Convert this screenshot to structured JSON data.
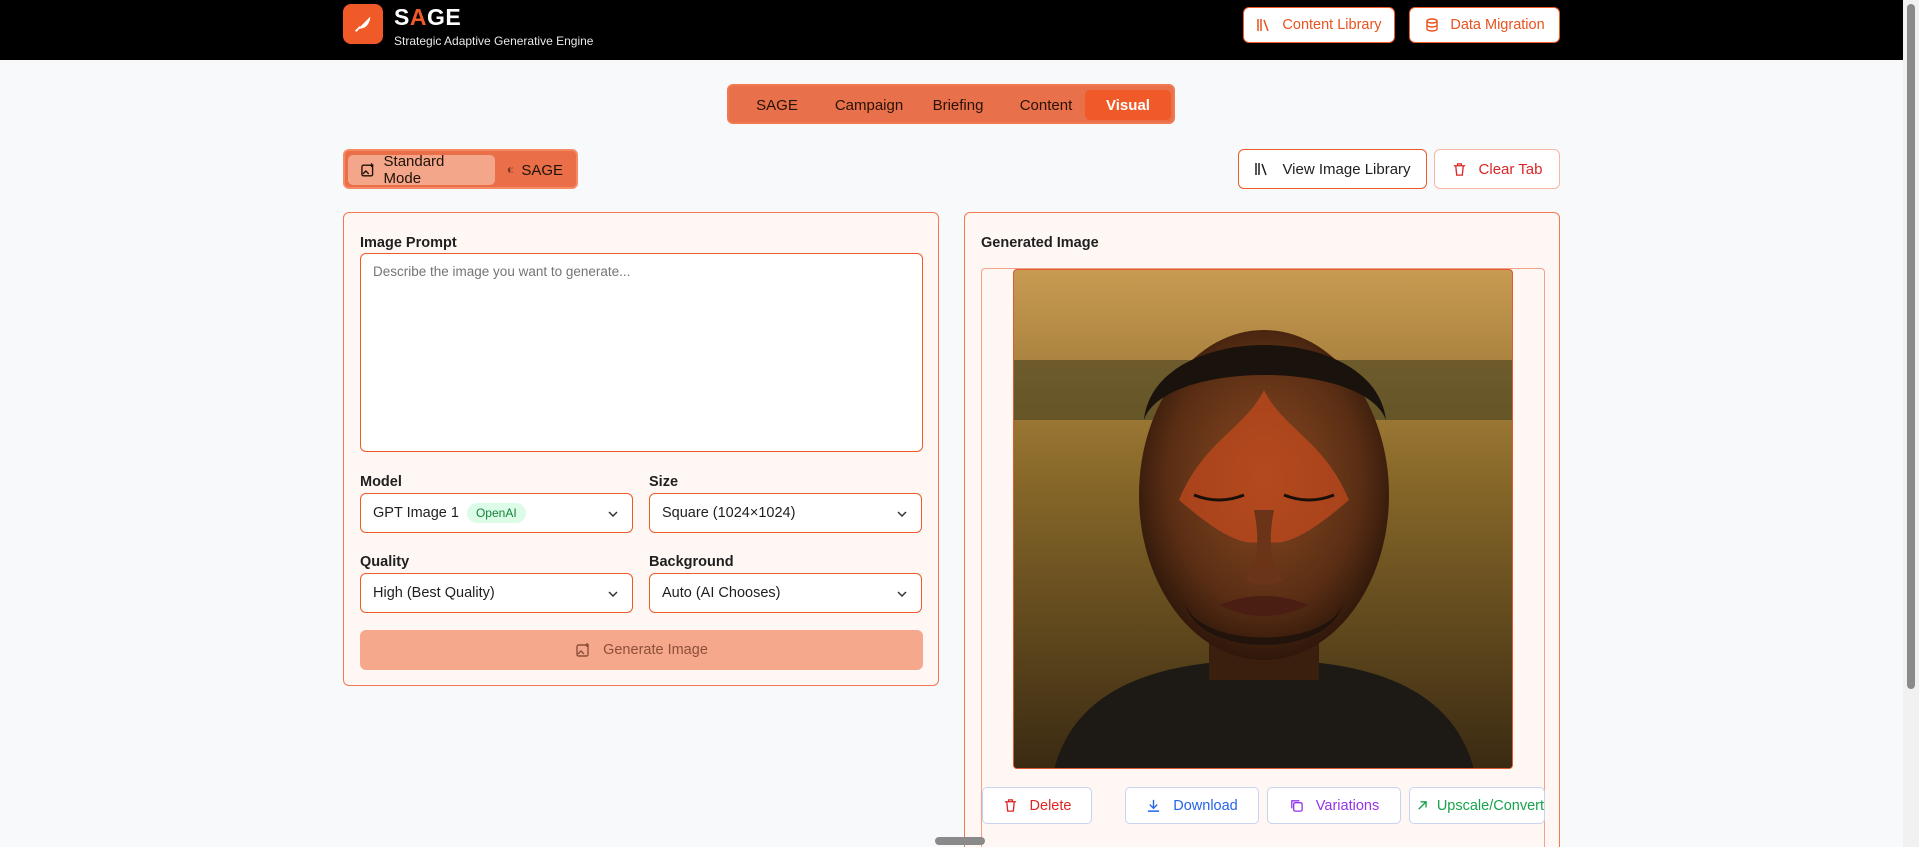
{
  "header": {
    "brand_prefix": "S",
    "brand_accent": "A",
    "brand_suffix": "GE",
    "tagline": "Strategic Adaptive Generative Engine",
    "content_library": "Content Library",
    "data_migration": "Data Migration"
  },
  "tabs": [
    "SAGE",
    "Campaign",
    "Briefing",
    "Content",
    "Visual"
  ],
  "active_tab": "Visual",
  "modes": {
    "standard": "Standard Mode",
    "sage": "SAGE",
    "active": "Standard Mode"
  },
  "actions": {
    "view_library": "View Image Library",
    "clear_tab": "Clear Tab"
  },
  "form": {
    "prompt_label": "Image Prompt",
    "prompt_placeholder": "Describe the image you want to generate...",
    "model_label": "Model",
    "model_value": "GPT Image 1",
    "model_badge": "OpenAI",
    "size_label": "Size",
    "size_value": "Square (1024×1024)",
    "quality_label": "Quality",
    "quality_value": "High (Best Quality)",
    "background_label": "Background",
    "background_value": "Auto (AI Chooses)",
    "generate": "Generate Image"
  },
  "result": {
    "title": "Generated Image",
    "delete": "Delete",
    "download": "Download",
    "variations": "Variations",
    "upscale": "Upscale/Convert"
  },
  "colors": {
    "accent": "#f05a28",
    "panel_bg": "#fff7f4",
    "header_bg": "#000000",
    "delete": "#dc2626",
    "download": "#2563eb",
    "variations": "#9333ea",
    "upscale": "#16a34a"
  },
  "icons": [
    "feather-icon",
    "library-icon",
    "database-icon",
    "image-plus-icon",
    "brain-icon",
    "trash-icon",
    "chevron-down-icon",
    "download-icon",
    "copy-icon",
    "arrow-up-right-icon"
  ]
}
